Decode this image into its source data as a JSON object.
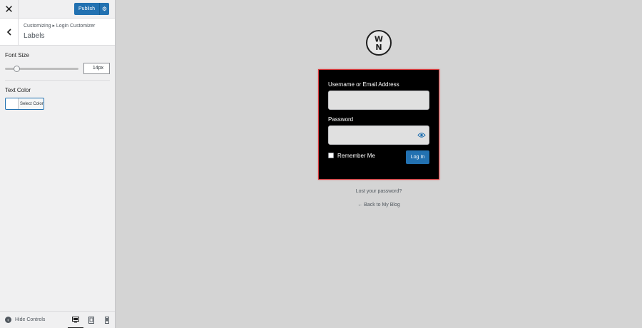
{
  "topbar": {
    "close_icon": "close-icon",
    "publish_label": "Publish",
    "settings_icon": "gear-icon",
    "accent_color": "#2271b1"
  },
  "section": {
    "breadcrumb": "Customizing ▸ Login Customizer",
    "title": "Labels",
    "back_icon": "chevron-left-icon"
  },
  "controls": {
    "font_size": {
      "label": "Font Size",
      "value": "14px",
      "slider_fraction": 0.16
    },
    "text_color": {
      "label": "Text Color",
      "button_label": "Select Color",
      "swatch_color": "#ffffff"
    }
  },
  "footer": {
    "hide_controls_label": "Hide Controls",
    "devices": [
      "desktop-icon",
      "tablet-icon",
      "mobile-icon"
    ],
    "active_device": "desktop"
  },
  "preview": {
    "logo_text_top": "W",
    "logo_text_bottom": "N",
    "username_label": "Username or Email Address",
    "password_label": "Password",
    "remember_label": "Remember Me",
    "login_button": "Log In",
    "lost_password": "Lost your password?",
    "back_to_blog": "← Back to My Blog",
    "form_bg": "#000000",
    "form_border": "#d63638"
  }
}
